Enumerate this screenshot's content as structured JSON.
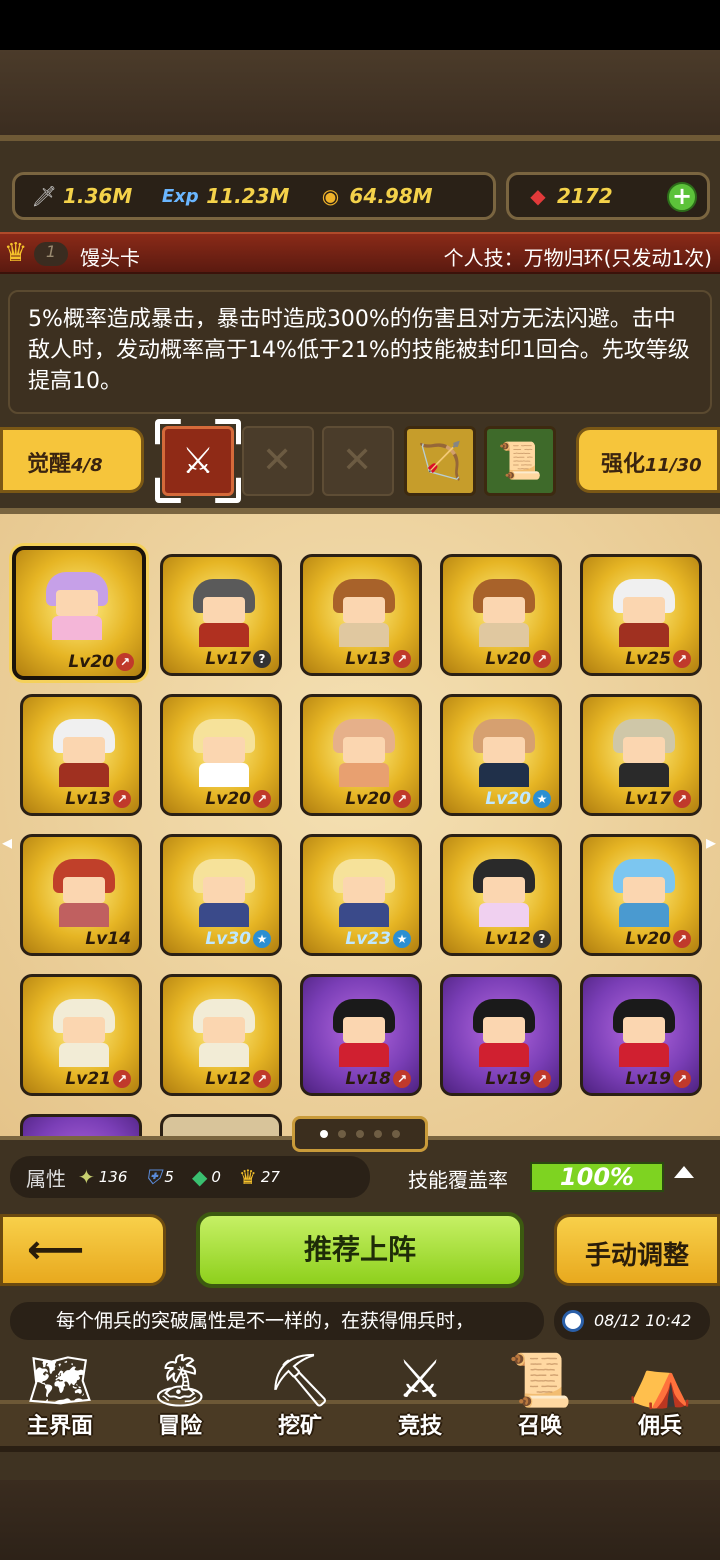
{
  "resources": [
    {
      "icon": "sword-icon",
      "glyph": "🗡",
      "value": "1.36M"
    },
    {
      "icon": "exp-icon",
      "glyph": "Exp",
      "value": "11.23M"
    },
    {
      "icon": "coin-icon",
      "glyph": "◉",
      "value": "64.98M"
    }
  ],
  "gems": {
    "icon": "ruby-icon",
    "value": "2172",
    "add": "+"
  },
  "card": {
    "level": "1",
    "name": "馒头卡",
    "skill": "个人技：万物归环(只发动1次)"
  },
  "description": "5%概率造成暴击，暴击时造成300%的伤害且对方无法闪避。击中敌人时，发动概率高于14%低于21%的技能被封印1回合。先攻等级提高10。",
  "awaken": {
    "label": "觉醒",
    "value": "4/8"
  },
  "strengthen": {
    "label": "强化",
    "value": "11/30"
  },
  "units": [
    {
      "lv": "Lv20",
      "badge": "red",
      "hair": "#c6a0e8",
      "body": "#f4b6d8"
    },
    {
      "lv": "Lv17",
      "badge": "q",
      "hair": "#5a5a5a",
      "body": "#b03020"
    },
    {
      "lv": "Lv13",
      "badge": "red",
      "hair": "#a8622a",
      "body": "#e0c8a0"
    },
    {
      "lv": "Lv20",
      "badge": "red",
      "hair": "#a8622a",
      "body": "#e0c8a0"
    },
    {
      "lv": "Lv25",
      "badge": "red",
      "hair": "#f0f0f0",
      "body": "#a03020"
    },
    {
      "lv": "Lv13",
      "badge": "red",
      "hair": "#f0f0f0",
      "body": "#a03020"
    },
    {
      "lv": "Lv20",
      "badge": "red",
      "hair": "#f6e29a",
      "body": "#ffffff"
    },
    {
      "lv": "Lv20",
      "badge": "red",
      "hair": "#e6b08a",
      "body": "#e8a070"
    },
    {
      "lv": "Lv20",
      "badge": "star",
      "hair": "#d6a070",
      "body": "#20304a"
    },
    {
      "lv": "Lv17",
      "badge": "red",
      "hair": "#cfc7a8",
      "body": "#2a2a2a"
    },
    {
      "lv": "Lv14",
      "badge": "",
      "hair": "#c0402a",
      "body": "#c06060"
    },
    {
      "lv": "Lv30",
      "badge": "star",
      "hair": "#f6e29a",
      "body": "#3a4a8a"
    },
    {
      "lv": "Lv23",
      "badge": "star",
      "hair": "#f6e29a",
      "body": "#3a4a8a"
    },
    {
      "lv": "Lv12",
      "badge": "q",
      "hair": "#2a2a2a",
      "body": "#f0d0f0"
    },
    {
      "lv": "Lv20",
      "badge": "red",
      "hair": "#7cc6f0",
      "body": "#4a9ad0"
    },
    {
      "lv": "Lv21",
      "badge": "red",
      "hair": "#f2ecd6",
      "body": "#f2ecd6"
    },
    {
      "lv": "Lv12",
      "badge": "red",
      "hair": "#f2ecd6",
      "body": "#f2ecd6"
    },
    {
      "lv": "Lv18",
      "badge": "red",
      "hair": "#1a1a1a",
      "body": "#d02030",
      "purple": true
    },
    {
      "lv": "Lv19",
      "badge": "red",
      "hair": "#1a1a1a",
      "body": "#d02030",
      "purple": true
    },
    {
      "lv": "Lv19",
      "badge": "red",
      "hair": "#1a1a1a",
      "body": "#d02030",
      "purple": true
    }
  ],
  "attributes": {
    "label": "属性",
    "items": [
      {
        "icon": "strength-icon",
        "glyph": "✦",
        "value": "136"
      },
      {
        "icon": "shield-icon",
        "glyph": "⛨",
        "value": "5"
      },
      {
        "icon": "gem-icon",
        "glyph": "◆",
        "value": "0"
      },
      {
        "icon": "crown-icon",
        "glyph": "♛",
        "value": "27"
      }
    ]
  },
  "coverage": {
    "label": "技能覆盖率",
    "value": "100%"
  },
  "buttons": {
    "recommend": "推荐上阵",
    "manual": "手动调整"
  },
  "ticker": "每个佣兵的突破属性是不一样的，在获得佣兵时，",
  "time": "08/12 10:42",
  "nav": [
    {
      "label": "主界面",
      "icon": "map-scroll-icon",
      "glyph": "🗺"
    },
    {
      "label": "冒险",
      "icon": "island-icon",
      "glyph": "🏝"
    },
    {
      "label": "挖矿",
      "icon": "pickaxe-icon",
      "glyph": "⛏"
    },
    {
      "label": "竞技",
      "icon": "crossed-swords-icon",
      "glyph": "⚔"
    },
    {
      "label": "召唤",
      "icon": "summon-scroll-icon",
      "glyph": "📜"
    },
    {
      "label": "佣兵",
      "icon": "tent-icon",
      "glyph": "⛺"
    }
  ]
}
